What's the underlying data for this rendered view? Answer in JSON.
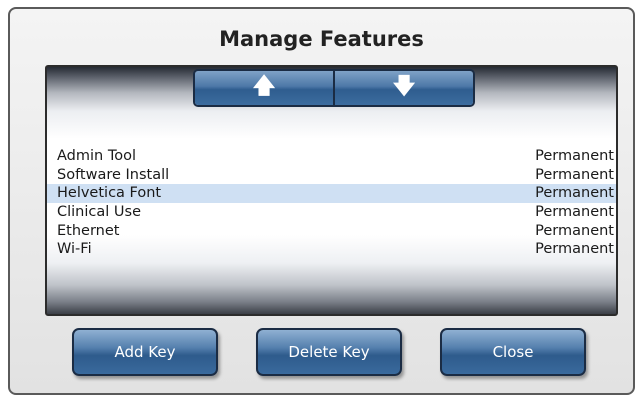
{
  "dialog": {
    "title": "Manage Features"
  },
  "scroll_buttons": {
    "up_icon": "arrow-up-icon",
    "up_glyph": "🡅",
    "down_icon": "arrow-down-icon",
    "down_glyph": "🡇"
  },
  "features": [
    {
      "name": "Admin Tool",
      "status": "Permanent",
      "selected": false
    },
    {
      "name": "Software Install",
      "status": "Permanent",
      "selected": false
    },
    {
      "name": "Helvetica Font",
      "status": "Permanent",
      "selected": true
    },
    {
      "name": "Clinical Use",
      "status": "Permanent",
      "selected": false
    },
    {
      "name": "Ethernet",
      "status": "Permanent",
      "selected": false
    },
    {
      "name": "Wi-Fi",
      "status": "Permanent",
      "selected": false
    }
  ],
  "buttons": {
    "add_key": "Add Key",
    "delete_key": "Delete Key",
    "close": "Close"
  },
  "colors": {
    "button_blue": "#4d78a7",
    "selection": "#cfe0f3"
  }
}
